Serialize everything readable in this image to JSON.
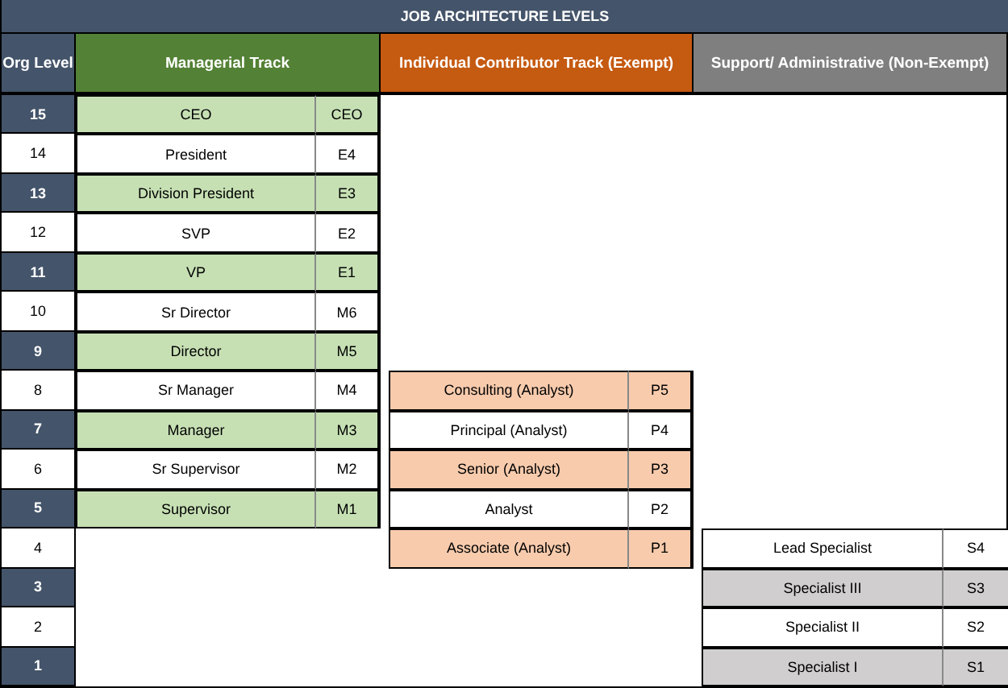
{
  "title": "JOB ARCHITECTURE LEVELS",
  "headers": [
    {
      "kind": "level",
      "label": "Org Level"
    },
    {
      "kind": "managerial",
      "label": "Managerial Track"
    },
    {
      "kind": "ic",
      "label": "Individual Contributor Track (Exempt)"
    },
    {
      "kind": "support",
      "label": "Support/ Administrative (Non-Exempt)"
    }
  ],
  "rows": [
    {
      "level": "15",
      "highlighted": true,
      "managerial": {
        "title": "CEO",
        "code": "CEO",
        "shaded": true
      }
    },
    {
      "level": "14",
      "highlighted": false,
      "managerial": {
        "title": "President",
        "code": "E4",
        "shaded": false
      }
    },
    {
      "level": "13",
      "highlighted": true,
      "managerial": {
        "title": "Division President",
        "code": "E3",
        "shaded": true
      }
    },
    {
      "level": "12",
      "highlighted": false,
      "managerial": {
        "title": "SVP",
        "code": "E2",
        "shaded": false
      }
    },
    {
      "level": "11",
      "highlighted": true,
      "managerial": {
        "title": "VP",
        "code": "E1",
        "shaded": true
      }
    },
    {
      "level": "10",
      "highlighted": false,
      "managerial": {
        "title": "Sr Director",
        "code": "M6",
        "shaded": false
      }
    },
    {
      "level": "9",
      "highlighted": true,
      "managerial": {
        "title": "Director",
        "code": "M5",
        "shaded": true
      }
    },
    {
      "level": "8",
      "highlighted": false,
      "managerial": {
        "title": "Sr Manager",
        "code": "M4",
        "shaded": false
      },
      "ic": {
        "title": "Consulting (Analyst)",
        "code": "P5",
        "shaded": true
      }
    },
    {
      "level": "7",
      "highlighted": true,
      "managerial": {
        "title": "Manager",
        "code": "M3",
        "shaded": true
      },
      "ic": {
        "title": "Principal (Analyst)",
        "code": "P4",
        "shaded": false
      }
    },
    {
      "level": "6",
      "highlighted": false,
      "managerial": {
        "title": "Sr Supervisor",
        "code": "M2",
        "shaded": false
      },
      "ic": {
        "title": "Senior (Analyst)",
        "code": "P3",
        "shaded": true
      }
    },
    {
      "level": "5",
      "highlighted": true,
      "managerial": {
        "title": "Supervisor",
        "code": "M1",
        "shaded": true
      },
      "ic": {
        "title": "Analyst",
        "code": "P2",
        "shaded": false
      }
    },
    {
      "level": "4",
      "highlighted": false,
      "ic": {
        "title": "Associate (Analyst)",
        "code": "P1",
        "shaded": true
      },
      "support": {
        "title": "Lead Specialist",
        "code": "S4",
        "shaded": false
      }
    },
    {
      "level": "3",
      "highlighted": true,
      "support": {
        "title": "Specialist III",
        "code": "S3",
        "shaded": true
      }
    },
    {
      "level": "2",
      "highlighted": false,
      "support": {
        "title": "Specialist II",
        "code": "S2",
        "shaded": false
      }
    },
    {
      "level": "1",
      "highlighted": true,
      "support": {
        "title": "Specialist I",
        "code": "S1",
        "shaded": true
      }
    }
  ]
}
